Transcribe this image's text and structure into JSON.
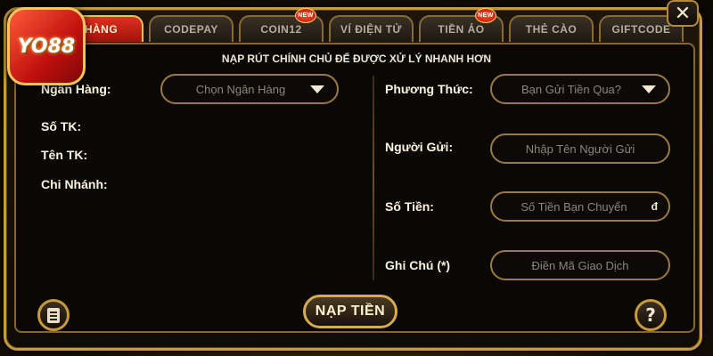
{
  "logo": {
    "text": "YO88"
  },
  "tabs": [
    {
      "label": "HÀNG",
      "active": true,
      "new": false
    },
    {
      "label": "CODEPAY",
      "active": false,
      "new": false
    },
    {
      "label": "COIN12",
      "active": false,
      "new": true
    },
    {
      "label": "VÍ ĐIỆN TỬ",
      "active": false,
      "new": false
    },
    {
      "label": "TIỀN ẢO",
      "active": false,
      "new": true
    },
    {
      "label": "THẺ CÀO",
      "active": false,
      "new": false
    },
    {
      "label": "GIFTCODE",
      "active": false,
      "new": false
    }
  ],
  "new_badge": "NEW",
  "close_label": "✕",
  "notice": "NẠP RÚT CHÍNH CHỦ ĐỂ ĐƯỢC XỬ LÝ NHANH HƠN",
  "left": {
    "bank_label": "Ngân Hàng:",
    "bank_select": "Chọn Ngân Hàng",
    "account_no_label": "Số TK:",
    "account_name_label": "Tên TK:",
    "branch_label": "Chi Nhánh:"
  },
  "right": {
    "method_label": "Phương Thức:",
    "method_select": "Bạn Gửi Tiền Qua?",
    "sender_label": "Người Gửi:",
    "sender_placeholder": "Nhập Tên Người Gửi",
    "amount_label": "Số Tiền:",
    "amount_placeholder": "Số Tiền Bạn Chuyển",
    "currency": "đ",
    "note_label": "Ghi Chú (*)",
    "note_placeholder": "Điền Mã Giao Dịch"
  },
  "deposit_button": "NẠP TIỀN",
  "help_label": "?",
  "colors": {
    "gold": "#c79a3a",
    "active_tab": "#e0301f",
    "background": "#0a0805"
  }
}
